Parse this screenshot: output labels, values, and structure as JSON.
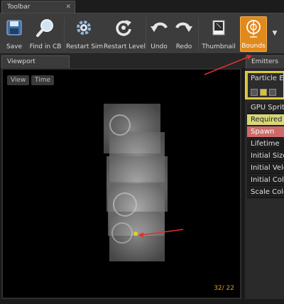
{
  "tabs": {
    "toolbar": "Toolbar",
    "viewport": "Viewport",
    "emitters": "Emitters"
  },
  "toolbar": {
    "save": "Save",
    "find_in_cb": "Find in CB",
    "restart_sim": "Restart Sim",
    "restart_level": "Restart Level",
    "undo": "Undo",
    "redo": "Redo",
    "thumbnail": "Thumbnail",
    "bounds": "Bounds"
  },
  "viewport": {
    "view_btn": "View",
    "time_btn": "Time",
    "frame_counter": "32/ 22"
  },
  "emitters": {
    "title": "Particle Em",
    "modules": [
      "GPU Sprite",
      "Required",
      "Spawn",
      "Lifetime",
      "Initial Size",
      "Initial Velo",
      "Initial Colo",
      "Scale Colo"
    ]
  },
  "colors": {
    "accent": "#e0891d",
    "required": "#d8d779",
    "spawn": "#d06a6a",
    "annotation_arrow": "#e03030"
  }
}
